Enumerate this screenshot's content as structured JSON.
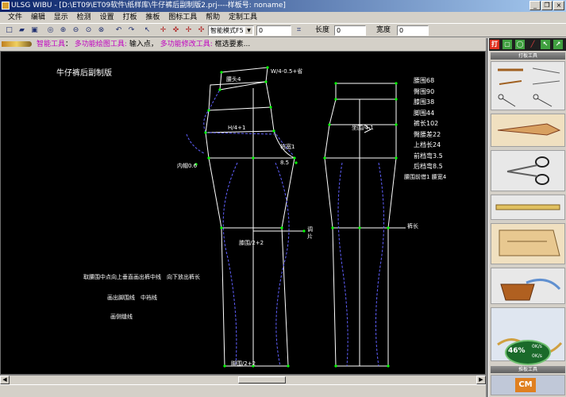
{
  "window": {
    "title": "ULSG WIBU - [D:\\ET09\\ET09软件\\纸样库\\牛仔裤后副制版2.prj----样板号: noname]",
    "minimize_glyph": "_",
    "restore_glyph": "❐",
    "close_glyph": "×"
  },
  "menu": {
    "items": [
      "文件",
      "编辑",
      "显示",
      "检测",
      "设置",
      "打板",
      "推板",
      "图标工具",
      "帮助",
      "定制工具"
    ]
  },
  "toolbar": {
    "mode_value": "智能模式F5",
    "value_field": "0",
    "length_label": "长度",
    "length_value": "0",
    "width_label": "宽度",
    "width_value": "0"
  },
  "prompt": {
    "prefix": "智能工具",
    "label1": "多功能绘图工具:",
    "text1": "输入点",
    "label2": "多功能修改工具:",
    "text2": "框选要素..."
  },
  "canvas": {
    "title": "牛仔裤后副制版",
    "labels": {
      "waist_formula": "W/4-0.5+省",
      "waistband": "腰头4",
      "hip_formula": "H/4+1",
      "front_hip": "坐围/4-1",
      "crotch_width": "裆宽1",
      "inseam": "内帽0.6",
      "crotch_ext": "8.5",
      "knee_back": "膝围/2+2",
      "knee_front": "膝围/2+2",
      "side_length": "裤长",
      "grain1": "调",
      "grain2": "片",
      "hem_back": "脚围/2+2",
      "note1": "取腰围中点向上垂直画出裤中线　向下放出裤长",
      "note2": "画出脚围线　中裆线",
      "note3": "画侧缝线"
    },
    "specs": [
      {
        "label": "腰围",
        "value": "68"
      },
      {
        "label": "臀围",
        "value": "90"
      },
      {
        "label": "膝围",
        "value": "38"
      },
      {
        "label": "脚围",
        "value": "44"
      },
      {
        "label": "裤长",
        "value": "102"
      },
      {
        "label": "臀腰差",
        "value": "22"
      },
      {
        "label": "上档长",
        "value": "24"
      },
      {
        "label": "前档弯",
        "value": "3.5"
      },
      {
        "label": "后档弯",
        "value": "8.5"
      },
      {
        "label": "腰围前借1",
        "value": "腰宽4"
      }
    ]
  },
  "side_panel": {
    "mode_buttons": [
      "打",
      "▢",
      "◯",
      "╱",
      "↖",
      "↗"
    ],
    "section_title_1": "打板工具",
    "section_title_2": "推板工具",
    "network": {
      "percent": "46%",
      "up": "0K/s",
      "down": "0K/s"
    }
  },
  "colors": {
    "canvas_bg": "#000000",
    "pattern_line": "#ffffff",
    "point": "#00ff00",
    "dash_line": "#6060ff"
  }
}
